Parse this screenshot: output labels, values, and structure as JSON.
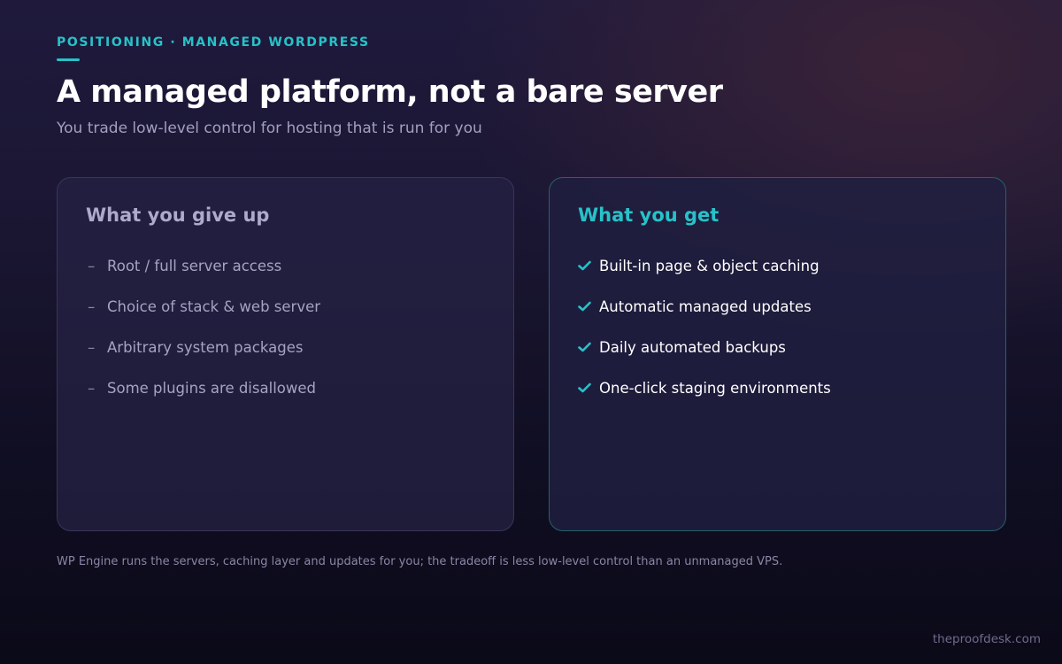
{
  "header": {
    "eyebrow": "POSITIONING · MANAGED WORDPRESS",
    "title": "A managed platform, not a bare server",
    "subtitle": "You trade low-level control for hosting that is run for you"
  },
  "give_up": {
    "heading": "What you give up",
    "marker": "–",
    "items": [
      "Root / full server access",
      "Choice of stack & web server",
      "Arbitrary system packages",
      "Some plugins are disallowed"
    ]
  },
  "get": {
    "heading": "What you get",
    "marker_icon": "checkmark-icon",
    "items": [
      "Built-in page & object caching",
      "Automatic managed updates",
      "Daily automated backups",
      "One-click staging environments"
    ]
  },
  "footnote": "WP Engine runs the servers, caching layer and updates for you; the tradeoff is less low-level control than an unmanaged VPS.",
  "brand": "theproofdesk.com",
  "colors": {
    "accent": "#27c2c9",
    "background": "#1a1632",
    "card": "#26224a",
    "muted_text": "#a49fbf"
  }
}
